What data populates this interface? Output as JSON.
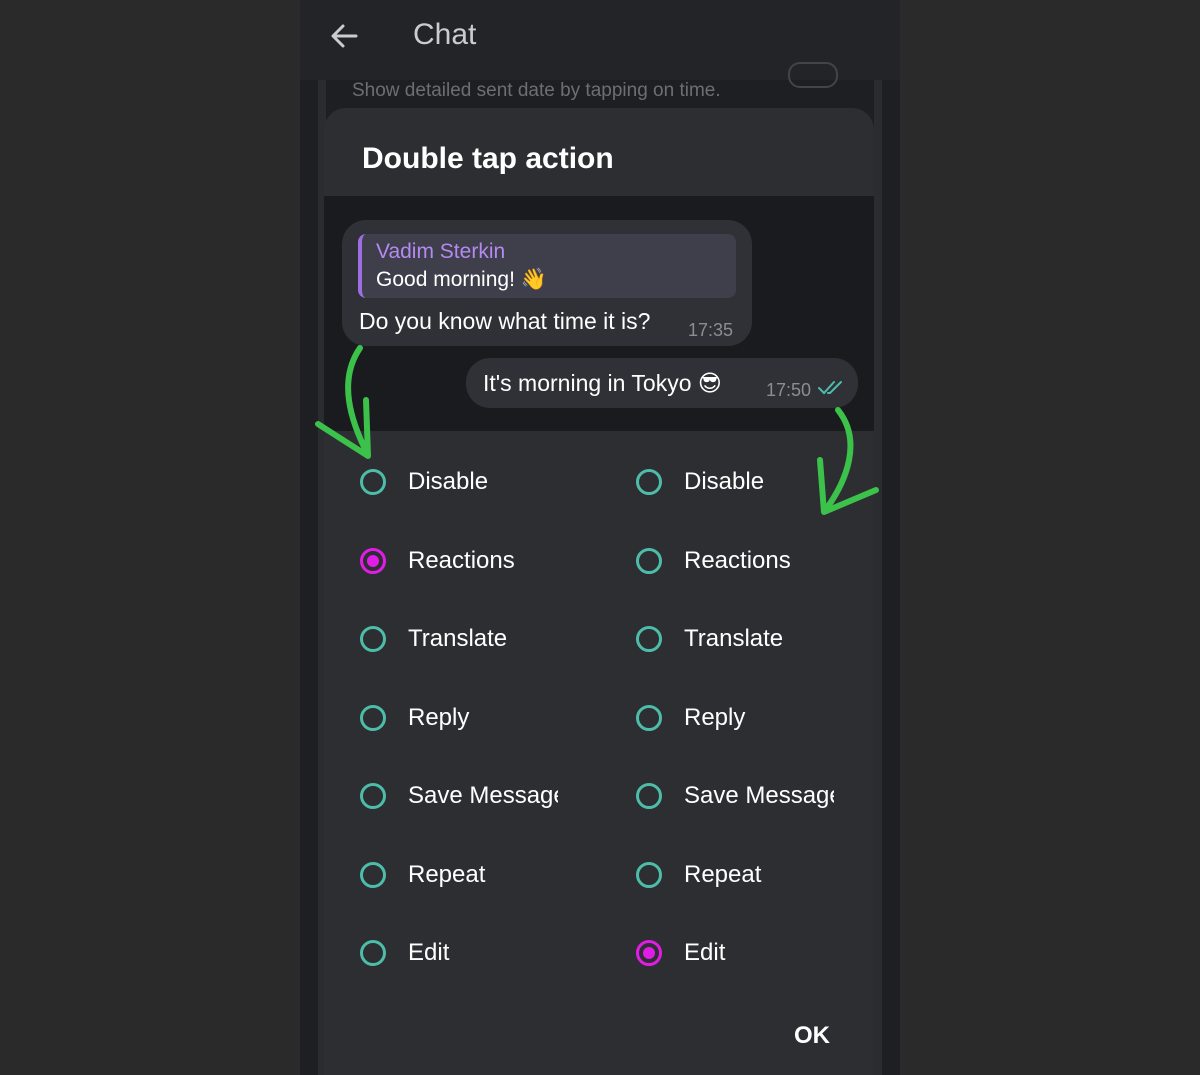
{
  "appbar": {
    "title": "Chat",
    "back_icon": "arrow-left-icon"
  },
  "background": {
    "setting_description": "Show detailed sent date by tapping on time."
  },
  "dialog": {
    "title": "Double tap action",
    "ok_label": "OK"
  },
  "preview": {
    "incoming": {
      "reply_name": "Vadim Sterkin",
      "reply_text": "Good morning! 👋",
      "text": "Do you know what time it is?",
      "time": "17:35"
    },
    "outgoing": {
      "text": "It's morning in Tokyo 😎",
      "time": "17:50",
      "status_icon": "double-check-icon"
    }
  },
  "left_options": [
    {
      "label": "Disable",
      "selected": false
    },
    {
      "label": "Reactions",
      "selected": true
    },
    {
      "label": "Translate",
      "selected": false
    },
    {
      "label": "Reply",
      "selected": false
    },
    {
      "label": "Save Message",
      "selected": false
    },
    {
      "label": "Repeat",
      "selected": false
    },
    {
      "label": "Edit",
      "selected": false
    }
  ],
  "right_options": [
    {
      "label": "Disable",
      "selected": false
    },
    {
      "label": "Reactions",
      "selected": false
    },
    {
      "label": "Translate",
      "selected": false
    },
    {
      "label": "Reply",
      "selected": false
    },
    {
      "label": "Save Message",
      "selected": false
    },
    {
      "label": "Repeat",
      "selected": false
    },
    {
      "label": "Edit",
      "selected": true
    }
  ],
  "colors": {
    "radio_unselected": "#4dbda9",
    "radio_selected": "#e01ce6",
    "reply_accent": "#9d6fe0",
    "annotation_arrow": "#3cc24a"
  }
}
